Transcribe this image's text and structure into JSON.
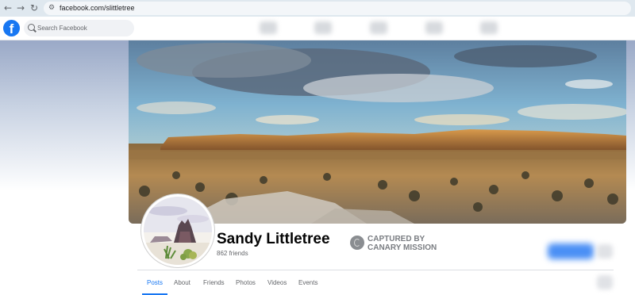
{
  "browser": {
    "back_glyph": "←",
    "forward_glyph": "→",
    "reload_glyph": "↻",
    "site_info_glyph": "⚙",
    "url": "facebook.com/slittletree"
  },
  "facebook": {
    "logo": "f",
    "brand_color": "#1877f2",
    "search_placeholder": "Search Facebook"
  },
  "profile": {
    "name": "Sandy Littletree",
    "friends": "862 friends"
  },
  "watermark": {
    "line1": "CAPTURED BY",
    "line2": "CANARY MISSION"
  },
  "tabs": [
    {
      "label": "Posts",
      "active": true
    },
    {
      "label": "About",
      "active": false
    },
    {
      "label": "Friends",
      "active": false
    },
    {
      "label": "Photos",
      "active": false
    },
    {
      "label": "Videos",
      "active": false
    },
    {
      "label": "Events",
      "active": false
    }
  ]
}
